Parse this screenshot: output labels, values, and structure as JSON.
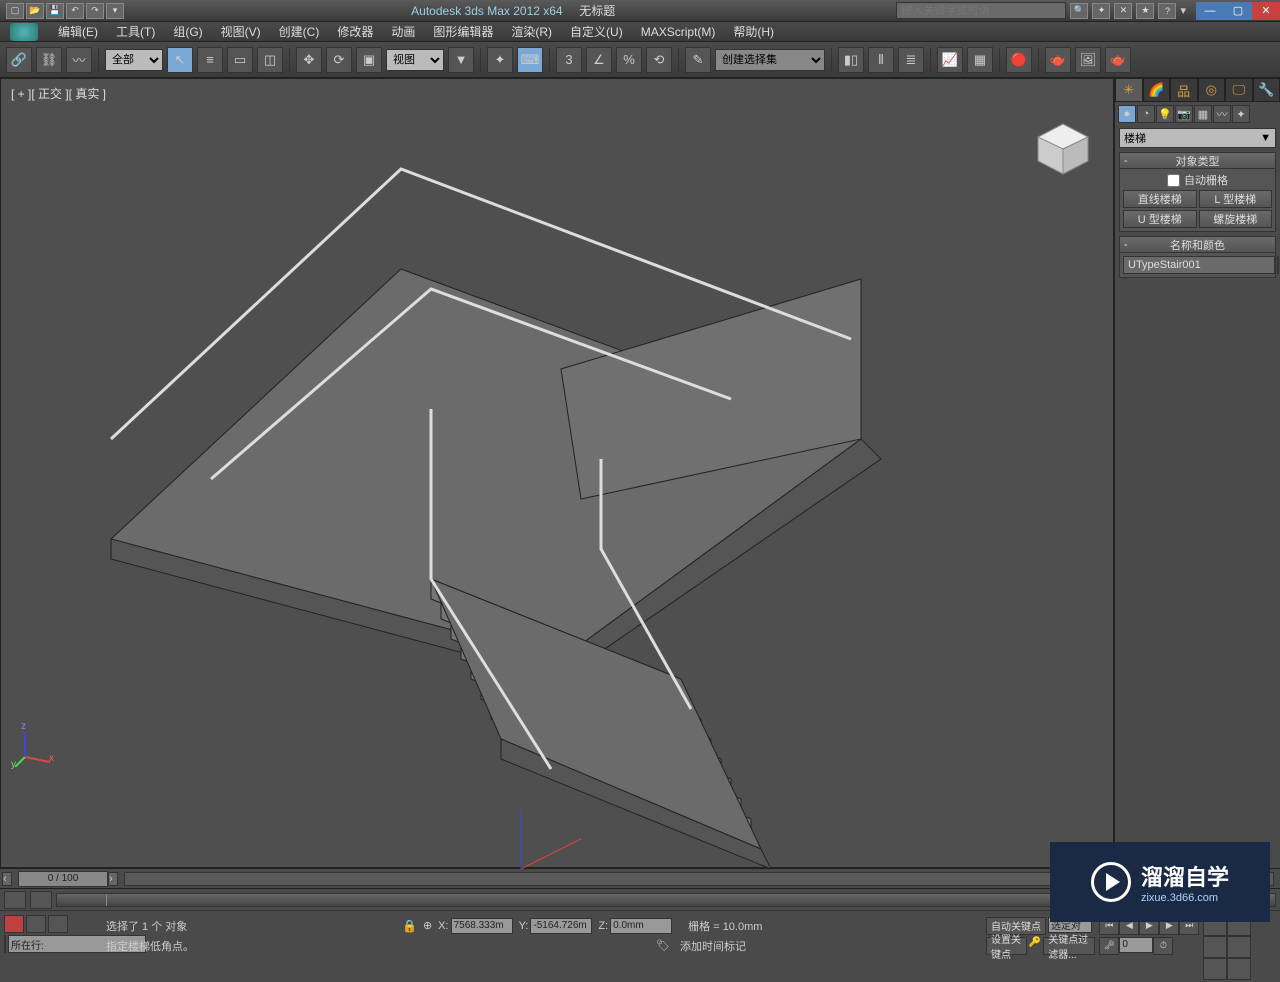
{
  "titlebar": {
    "app": "Autodesk 3ds Max  2012 x64",
    "doc": "无标题",
    "search_placeholder": "键入关键字或短语"
  },
  "menu": {
    "items": [
      "编辑(E)",
      "工具(T)",
      "组(G)",
      "视图(V)",
      "创建(C)",
      "修改器",
      "动画",
      "图形编辑器",
      "渲染(R)",
      "自定义(U)",
      "MAXScript(M)",
      "帮助(H)"
    ]
  },
  "toolbar": {
    "filter_select": "全部",
    "refcoord_select": "视图",
    "named_set_placeholder": "创建选择集"
  },
  "viewport": {
    "label": "[ + ][ 正交 ][ 真实 ]",
    "axes": {
      "x": "x",
      "y": "y",
      "z": "z"
    }
  },
  "command_panel": {
    "dropdown": "楼梯",
    "rollout_obj": {
      "title": "对象类型",
      "autogrid": "自动栅格",
      "buttons": [
        "直线楼梯",
        "L 型楼梯",
        "U 型楼梯",
        "螺旋楼梯"
      ]
    },
    "rollout_name": {
      "title": "名称和颜色",
      "name": "UTypeStair001"
    }
  },
  "timeline": {
    "slider": "0 / 100"
  },
  "status": {
    "row_label": "所在行:",
    "selection": "选择了 1 个 对象",
    "prompt": "指定楼梯低角点。",
    "x": "7568.333m",
    "y": "-5164.726m",
    "z": "0.0mm",
    "grid": "栅格 = 10.0mm",
    "add_time_tag": "添加时间标记",
    "auto_key": "自动关键点",
    "set_key": "设置关键点",
    "selected": "选定对",
    "key_filter": "关键点过滤器..."
  },
  "watermark": {
    "title": "溜溜自学",
    "sub": "zixue.3d66.com"
  }
}
